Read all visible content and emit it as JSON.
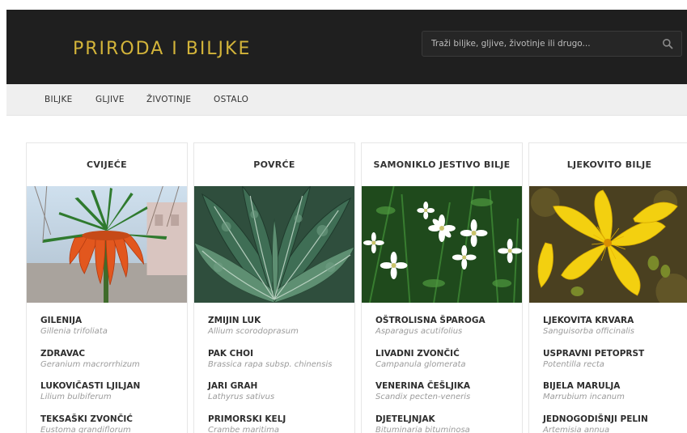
{
  "site": {
    "title": "PRIRODA I BILJKE",
    "search_placeholder": "Traži biljke, gljive, životinje ili drugo...",
    "accent_color": "#d3b43a",
    "header_bg": "#1f1f1f",
    "search_icon": "search-icon"
  },
  "nav": {
    "items": [
      "BILJKE",
      "GLJIVE",
      "ŽIVOTINJE",
      "OSTALO"
    ]
  },
  "cards": [
    {
      "title": "CVIJEĆE",
      "image": "crown-imperial-flower",
      "entries": [
        {
          "name": "GILENIJA",
          "latin": "Gillenia trifoliata"
        },
        {
          "name": "ZDRAVAC",
          "latin": "Geranium macrorrhizum"
        },
        {
          "name": "LUKOVIČASTI LJILJAN",
          "latin": "Lilium bulbiferum"
        },
        {
          "name": "TEKSAŠKI ZVONČIĆ",
          "latin": "Eustoma grandiflorum"
        }
      ]
    },
    {
      "title": "POVRĆE",
      "image": "kale-leaves",
      "entries": [
        {
          "name": "ZMIJIN LUK",
          "latin": "Allium scorodoprasum"
        },
        {
          "name": "PAK CHOI",
          "latin": "Brassica rapa subsp. chinensis"
        },
        {
          "name": "JARI GRAH",
          "latin": "Lathyrus sativus"
        },
        {
          "name": "PRIMORSKI KELJ",
          "latin": "Crambe maritima"
        }
      ]
    },
    {
      "title": "SAMONIKLO JESTIVO BILJE",
      "image": "white-stitchwort-flowers",
      "entries": [
        {
          "name": "OŠTROLISNA ŠPAROGA",
          "latin": "Asparagus acutifolius"
        },
        {
          "name": "LIVADNI ZVONČIĆ",
          "latin": "Campanula glomerata"
        },
        {
          "name": "VENERINA ČEŠLJIKA",
          "latin": "Scandix pecten-veneris"
        },
        {
          "name": "DJETELJNJAK",
          "latin": "Bituminaria bituminosa"
        }
      ]
    },
    {
      "title": "LJEKOVITO BILJE",
      "image": "st-johns-wort-flower",
      "entries": [
        {
          "name": "LJEKOVITA KRVARA",
          "latin": "Sanguisorba officinalis"
        },
        {
          "name": "USPRAVNI PETOPRST",
          "latin": "Potentilla recta"
        },
        {
          "name": "BIJELA MARULJA",
          "latin": "Marrubium incanum"
        },
        {
          "name": "JEDNOGODIŠNJI PELIN",
          "latin": "Artemisia annua"
        }
      ]
    }
  ]
}
